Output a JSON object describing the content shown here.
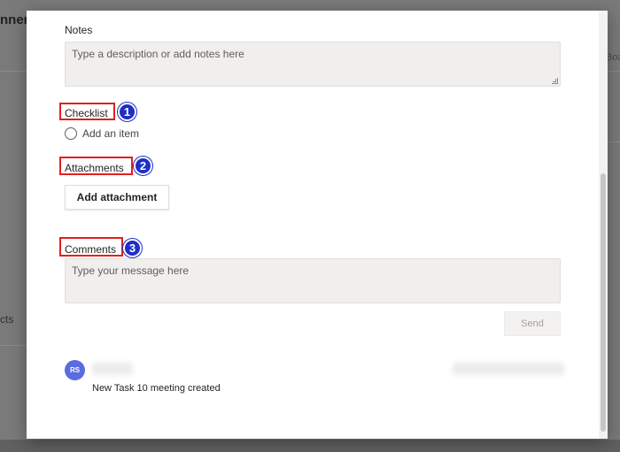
{
  "background": {
    "app_title_fragment": "nner",
    "right_fragment": "Boa",
    "left_fragment": "cts"
  },
  "task": {
    "notes_label": "Notes",
    "notes_placeholder": "Type a description or add notes here",
    "checklist_label": "Checklist",
    "add_item_label": "Add an item",
    "attachments_label": "Attachments",
    "add_attachment_label": "Add attachment",
    "comments_label": "Comments",
    "comment_placeholder": "Type your message here",
    "send_label": "Send"
  },
  "annotations": {
    "badge_1": "1",
    "badge_2": "2",
    "badge_3": "3",
    "box_color": "#e02020",
    "badge_color": "#1e2fc7"
  },
  "activity": {
    "avatar_initials": "RS",
    "message": "New Task 10 meeting created"
  }
}
